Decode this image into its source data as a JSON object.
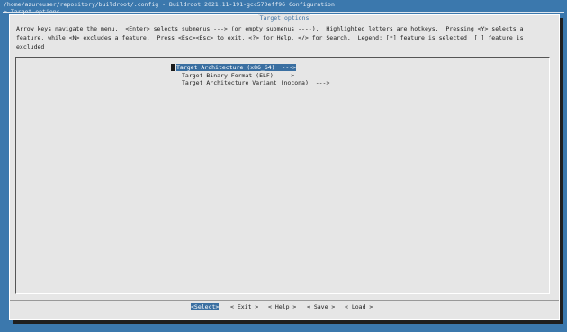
{
  "window": {
    "title": "/home/azureuser/repository/buildroot/.config - Buildroot 2021.11-191-gcc570eff96 Configuration",
    "breadcrumb": "> Target options"
  },
  "dialog": {
    "title": "Target options",
    "help_text": "Arrow keys navigate the menu.  <Enter> selects submenus ---> (or empty submenus ----).  Highlighted letters are hotkeys.  Pressing <Y> selects a feature, while <N> excludes a feature.  Press <Esc><Esc> to exit, <?> for Help, </> for Search.  Legend: [*] feature is selected  [ ] feature is excluded"
  },
  "menu": {
    "items": [
      {
        "label": "Target Architecture (x86_64)  --->",
        "selected": true
      },
      {
        "label": "Target Binary Format (ELF)  --->",
        "selected": false
      },
      {
        "label": "Target Architecture Variant (nocona)  --->",
        "selected": false
      }
    ]
  },
  "buttons": {
    "select": "<Select>",
    "exit": "< Exit >",
    "help": "< Help >",
    "save": "< Save >",
    "load": "< Load >"
  },
  "colors": {
    "background": "#3b78ad",
    "dialog": "#e6e6e6",
    "highlight": "#3a6fa1"
  }
}
